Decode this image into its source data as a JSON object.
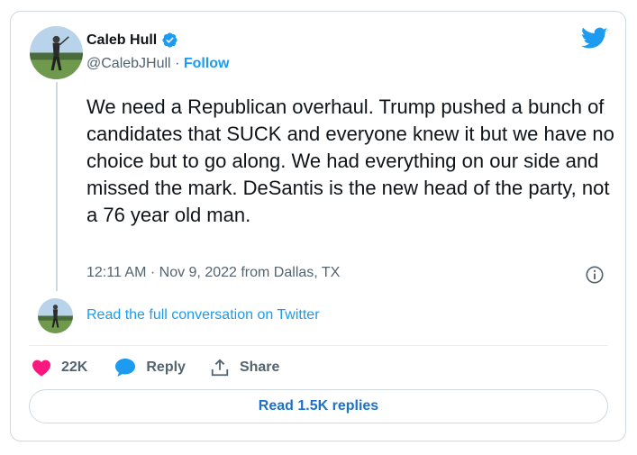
{
  "tweet": {
    "author_name": "Caleb Hull",
    "handle": "@CalebJHull",
    "separator": "·",
    "follow_label": "Follow",
    "text": "We need a Republican overhaul. Trump pushed a bunch of candidates that SUCK and everyone knew it but we have no choice but to go along. We had everything on our side and missed the mark. DeSantis is the new head of the party, not a 76 year old man.",
    "timestamp": "12:11 AM · Nov 9, 2022 from Dallas, TX",
    "read_conversation_label": "Read the full conversation on Twitter"
  },
  "actions": {
    "like_count": "22K",
    "reply_label": "Reply",
    "share_label": "Share"
  },
  "replies_button_label": "Read 1.5K replies",
  "icons": {
    "verified": "verified-badge-icon",
    "brand": "twitter-bird-icon",
    "info": "info-icon",
    "like": "heart-icon",
    "reply": "speech-bubble-icon",
    "share": "share-arrow-icon"
  },
  "colors": {
    "brand_blue": "#1d9bf0",
    "like_pink": "#f91880",
    "text_primary": "#0f1419",
    "text_secondary": "#536471",
    "border": "#cfd9de",
    "replies_link": "#1d72c4"
  }
}
